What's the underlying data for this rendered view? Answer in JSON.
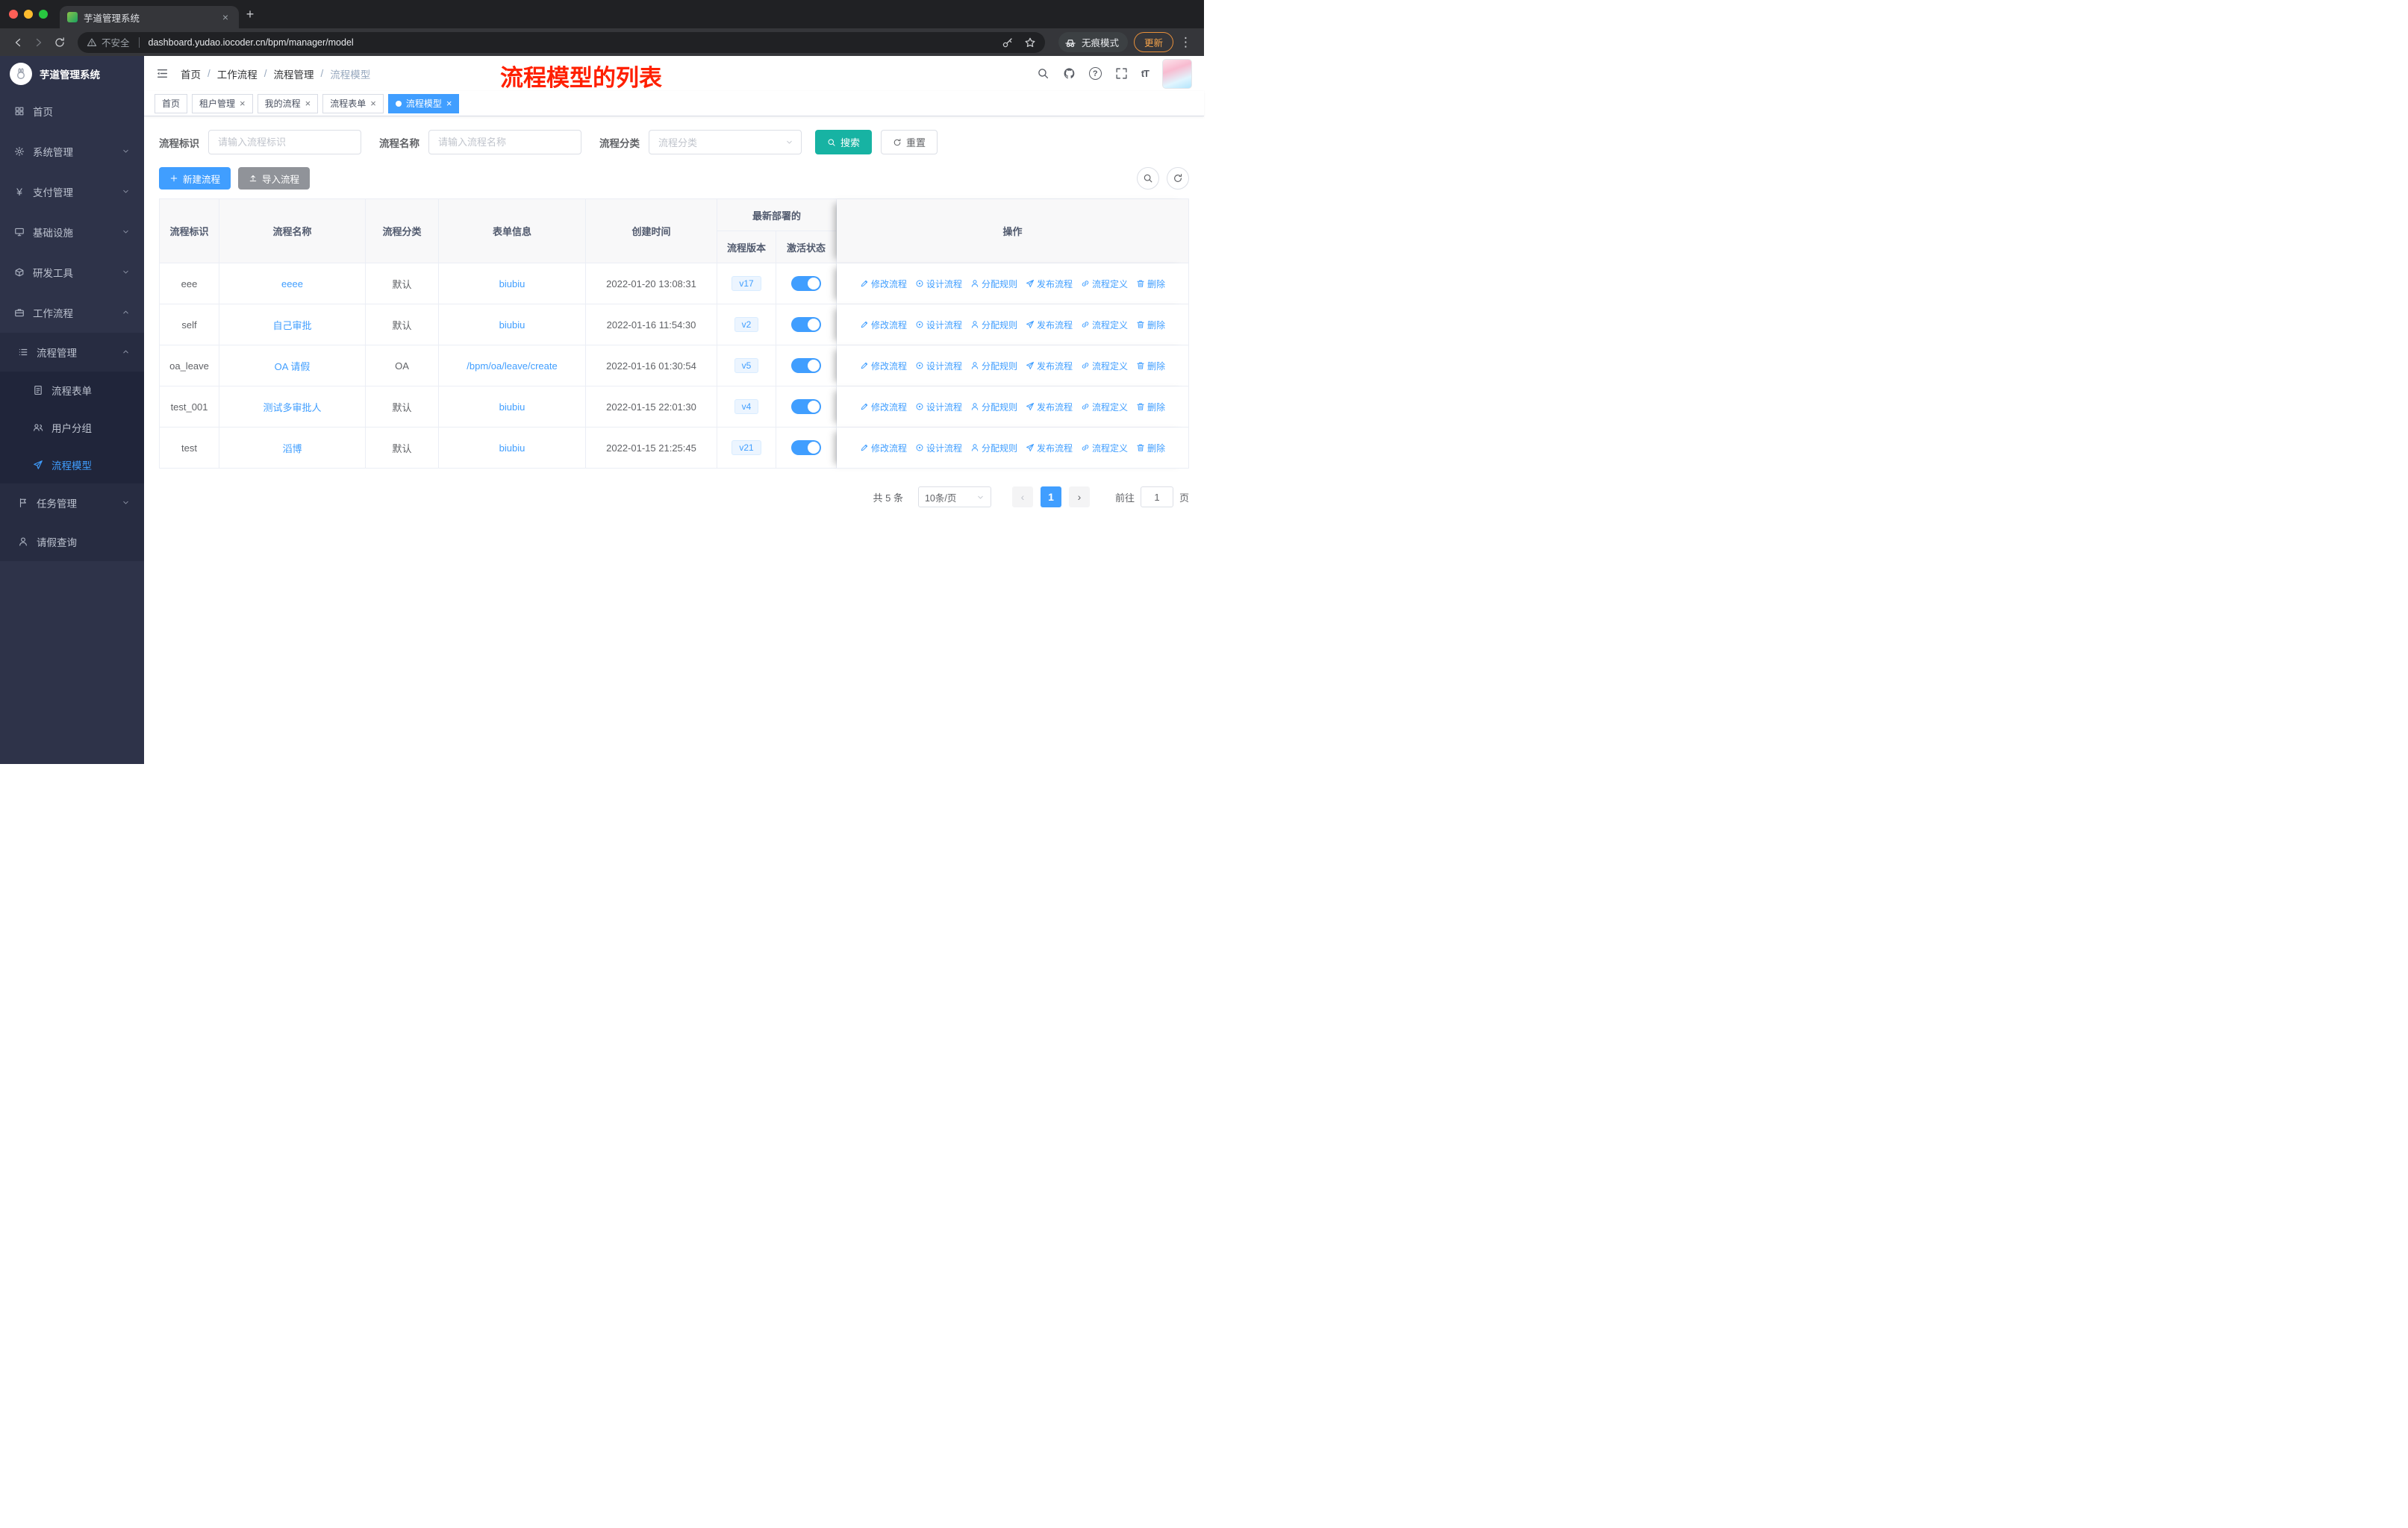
{
  "browser": {
    "tab_title": "芋道管理系统",
    "security_text": "不安全",
    "url": "dashboard.yudao.iocoder.cn/bpm/manager/model",
    "incognito_label": "无痕模式",
    "update_label": "更新"
  },
  "icons": {
    "close": "×",
    "plus": "+",
    "menu_dots": "⋮",
    "prev": "‹",
    "next": "›",
    "breadcrumb_sep": "/",
    "yen": "¥",
    "text_size": "tT",
    "question": "?"
  },
  "sidebar": {
    "logo_title": "芋道管理系统",
    "menu": [
      {
        "label": "首页"
      },
      {
        "label": "系统管理"
      },
      {
        "label": "支付管理"
      },
      {
        "label": "基础设施"
      },
      {
        "label": "研发工具"
      },
      {
        "label": "工作流程"
      }
    ],
    "submenu": {
      "label": "流程管理",
      "items": [
        {
          "label": "流程表单"
        },
        {
          "label": "用户分组"
        },
        {
          "label": "流程模型"
        }
      ]
    },
    "menu_after": [
      {
        "label": "任务管理"
      },
      {
        "label": "请假查询"
      }
    ]
  },
  "header": {
    "breadcrumb": [
      "首页",
      "工作流程",
      "流程管理",
      "流程模型"
    ],
    "annotation": "流程模型的列表"
  },
  "tags": [
    {
      "label": "首页"
    },
    {
      "label": "租户管理"
    },
    {
      "label": "我的流程"
    },
    {
      "label": "流程表单"
    },
    {
      "label": "流程模型"
    }
  ],
  "filters": {
    "id_label": "流程标识",
    "id_placeholder": "请输入流程标识",
    "name_label": "流程名称",
    "name_placeholder": "请输入流程名称",
    "category_label": "流程分类",
    "category_placeholder": "流程分类",
    "search_label": "搜索",
    "reset_label": "重置"
  },
  "toolbar_buttons": {
    "create_label": "新建流程",
    "import_label": "导入流程"
  },
  "table": {
    "headers": {
      "id": "流程标识",
      "name": "流程名称",
      "category": "流程分类",
      "form": "表单信息",
      "created": "创建时间",
      "deploy_group": "最新部署的",
      "version": "流程版本",
      "active": "激活状态",
      "actions": "操作"
    },
    "actions": [
      "修改流程",
      "设计流程",
      "分配规则",
      "发布流程",
      "流程定义",
      "删除"
    ],
    "rows": [
      {
        "id": "eee",
        "name": "eeee",
        "category": "默认",
        "form": "biubiu",
        "created": "2022-01-20 13:08:31",
        "version": "v17",
        "active": true
      },
      {
        "id": "self",
        "name": "自己审批",
        "category": "默认",
        "form": "biubiu",
        "created": "2022-01-16 11:54:30",
        "version": "v2",
        "active": true
      },
      {
        "id": "oa_leave",
        "name": "OA 请假",
        "category": "OA",
        "form": "/bpm/oa/leave/create",
        "created": "2022-01-16 01:30:54",
        "version": "v5",
        "active": true
      },
      {
        "id": "test_001",
        "name": "测试多审批人",
        "category": "默认",
        "form": "biubiu",
        "created": "2022-01-15 22:01:30",
        "version": "v4",
        "active": true
      },
      {
        "id": "test",
        "name": "滔博",
        "category": "默认",
        "form": "biubiu",
        "created": "2022-01-15 21:25:45",
        "version": "v21",
        "active": true
      }
    ]
  },
  "pagination": {
    "total_text": "共 5 条",
    "page_size": "10条/页",
    "current_page": "1",
    "goto_label": "前往",
    "goto_value": "1",
    "page_label": "页"
  },
  "colors": {
    "accent": "#409eff",
    "search_button": "#17b3a3",
    "import_button": "#909399",
    "annotation_red": "#ff2000",
    "sidebar_bg": "#2e3349",
    "version_tag_bg": "#ecf5ff",
    "toggle_on": "#409eff"
  }
}
